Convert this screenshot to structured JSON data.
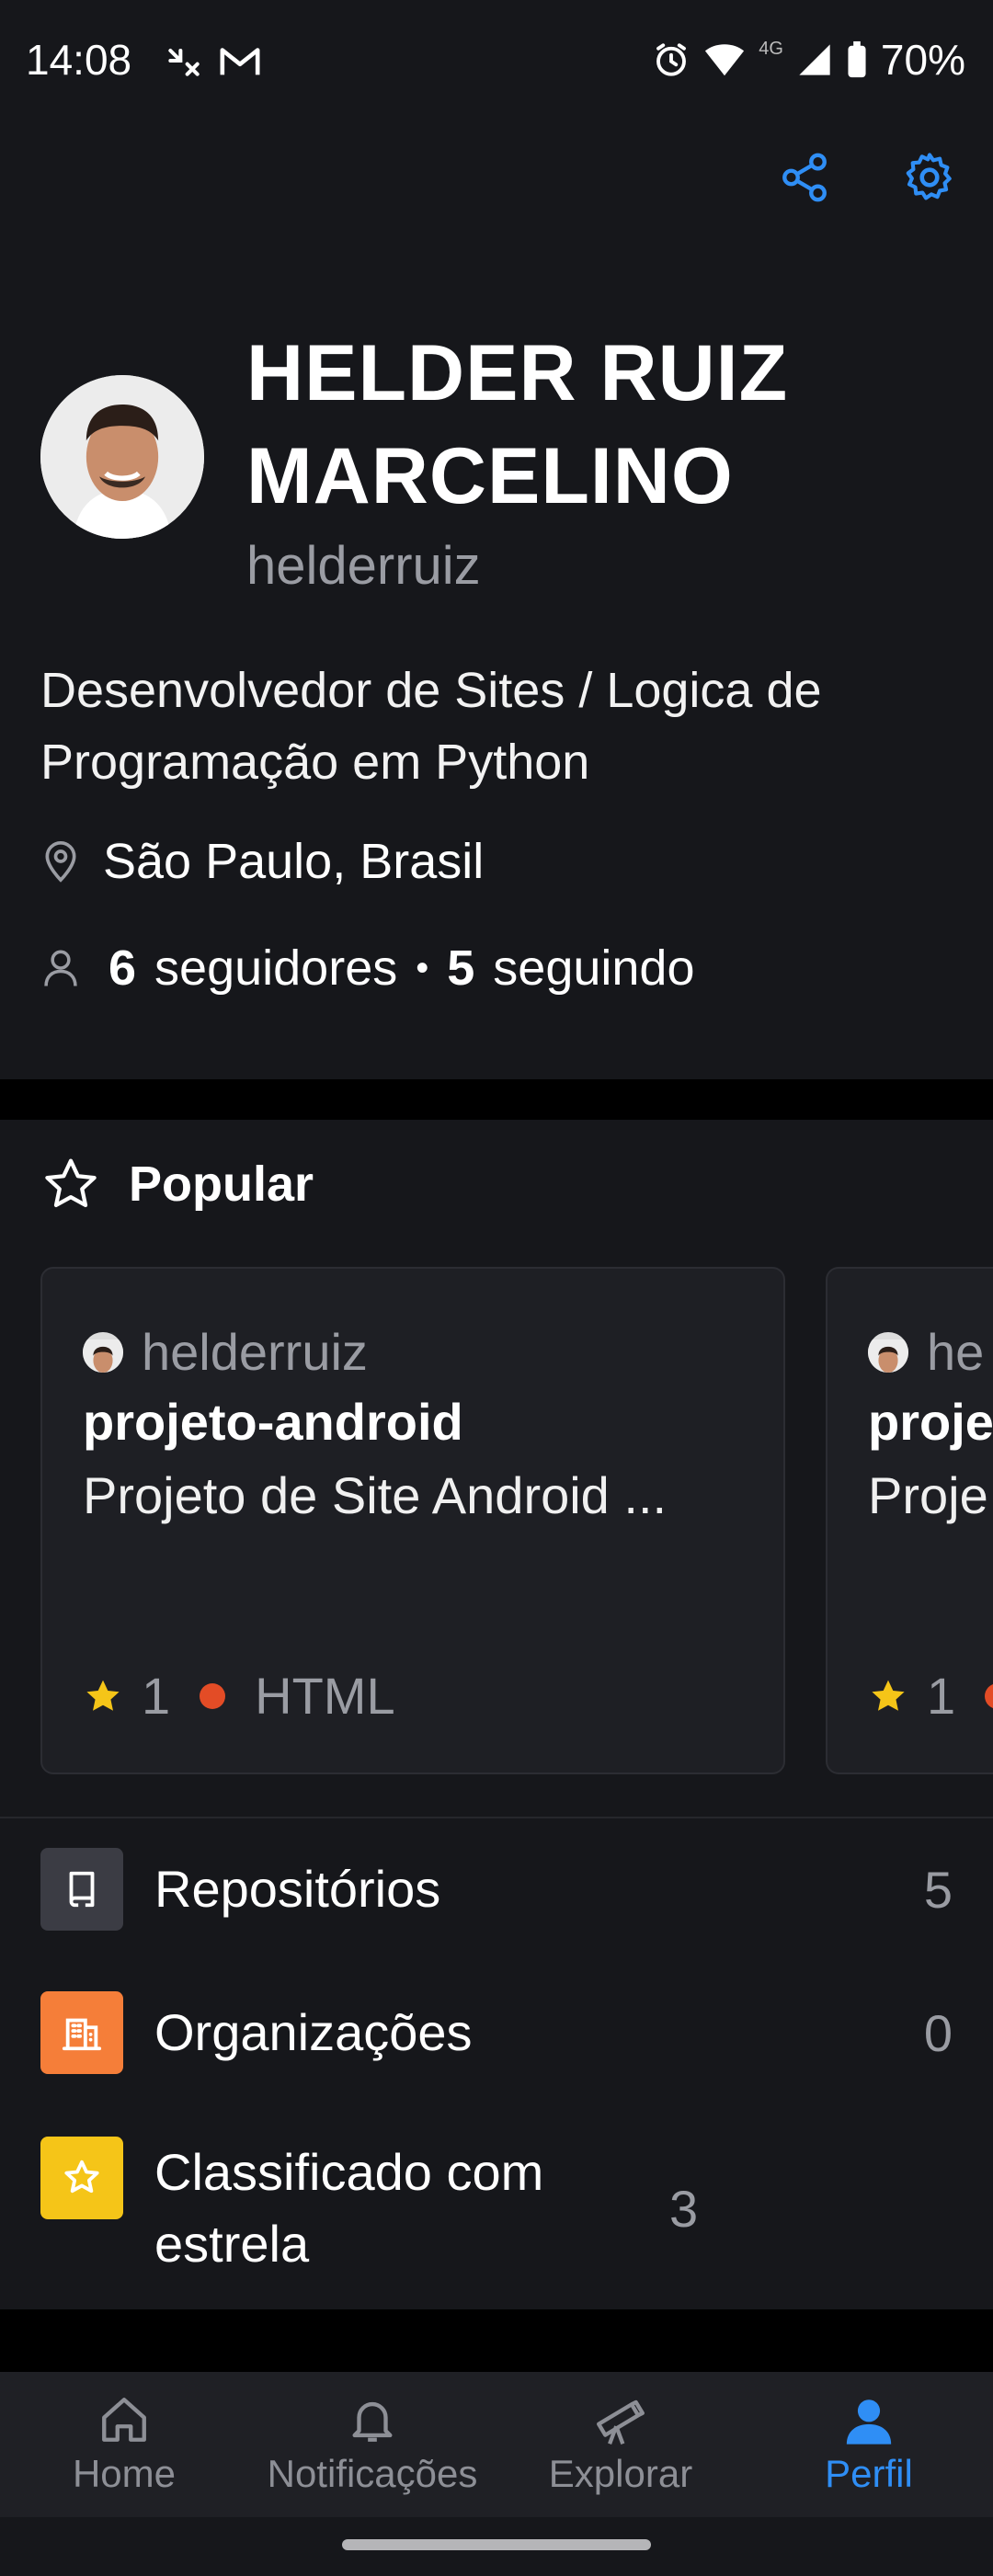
{
  "status_bar": {
    "time": "14:08",
    "network": "4G",
    "battery": "70%"
  },
  "profile": {
    "name": "HELDER RUIZ MARCELINO",
    "username": "helderruiz",
    "bio": "Desenvolvedor de Sites / Logica de Programação em Python",
    "location": "São Paulo, Brasil",
    "followers_count": "6",
    "followers_label": "seguidores",
    "separator": "•",
    "following_count": "5",
    "following_label": "seguindo"
  },
  "popular": {
    "title": "Popular",
    "cards": [
      {
        "owner": "helderruiz",
        "name": "projeto-android",
        "description": "Projeto de Site Android ...",
        "stars": "1",
        "language": "HTML"
      },
      {
        "owner": "he",
        "name": "proje",
        "description": "Proje",
        "stars": "1",
        "language": ""
      }
    ]
  },
  "list": [
    {
      "label": "Repositórios",
      "count": "5",
      "icon": "repo-icon",
      "color": "#3b3c44"
    },
    {
      "label": "Organizações",
      "count": "0",
      "icon": "organization-icon",
      "color": "#f57e39"
    },
    {
      "label": "Classificado com estrela",
      "count": "3",
      "icon": "star-icon",
      "color": "#f5c518"
    }
  ],
  "nav": {
    "home": "Home",
    "notifications": "Notificações",
    "explore": "Explorar",
    "profile": "Perfil"
  },
  "colors": {
    "accent": "#2f8ef5",
    "background": "#16171b",
    "lang_html": "#e34c26"
  }
}
